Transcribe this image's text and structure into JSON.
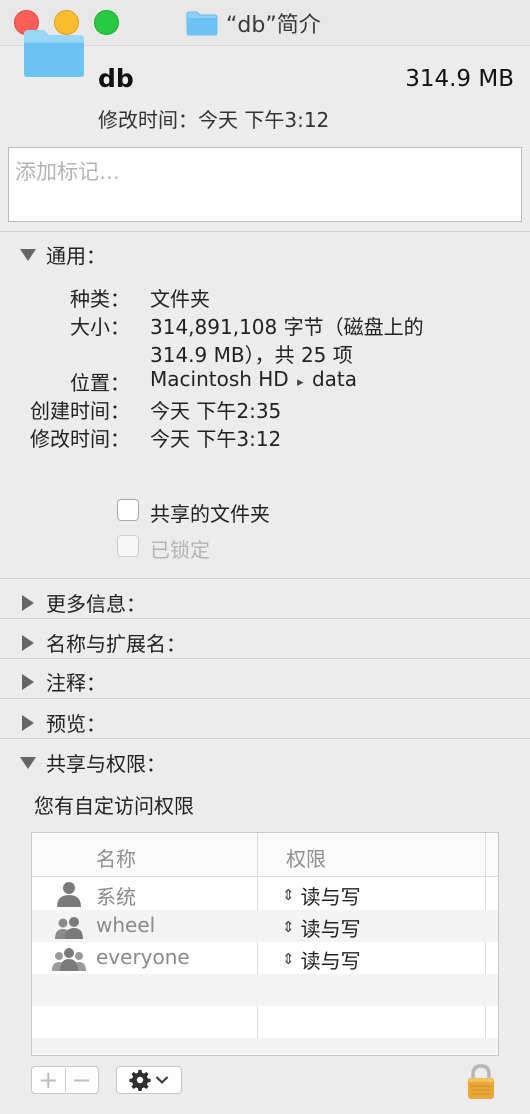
{
  "window": {
    "title": "“db”简介"
  },
  "header": {
    "name": "db",
    "size": "314.9 MB",
    "modified": "修改时间：今天 下午3:12"
  },
  "tags": {
    "placeholder": "添加标记…"
  },
  "general": {
    "heading": "通用：",
    "rows": [
      {
        "label": "种类：",
        "value": "文件夹"
      },
      {
        "label": "大小：",
        "value": "314,891,108 字节（磁盘上的"
      },
      {
        "label": "",
        "value": "314.9 MB），共 25 项"
      },
      {
        "label": "位置：",
        "value_a": "Macintosh HD",
        "value_sep": "▸",
        "value_b": "data"
      },
      {
        "label": "创建时间：",
        "value": "今天 下午2:35"
      },
      {
        "label": "修改时间：",
        "value": "今天 下午3:12"
      }
    ],
    "shared_folder_label": "共享的文件夹",
    "locked_label": "已锁定"
  },
  "sections": {
    "more_info": "更多信息：",
    "name_ext": "名称与扩展名：",
    "comments": "注释：",
    "preview": "预览：",
    "sharing": "共享与权限："
  },
  "permissions": {
    "note": "您有自定访问权限",
    "col_name": "名称",
    "col_priv": "权限",
    "rows": [
      {
        "name": "系统",
        "privilege": "读与写",
        "icon": "single-user-icon"
      },
      {
        "name": "wheel",
        "privilege": "读与写",
        "icon": "group-icon"
      },
      {
        "name": "everyone",
        "privilege": "读与写",
        "icon": "everyone-icon"
      }
    ]
  },
  "toolbar": {
    "add": "+",
    "remove": "−",
    "gear": "gear-icon",
    "lock": "lock-icon"
  },
  "colors": {
    "folder_blue": "#6cc3f3",
    "close": "#fc5f57",
    "minimize": "#fdbc2e",
    "maximize": "#28c840"
  }
}
